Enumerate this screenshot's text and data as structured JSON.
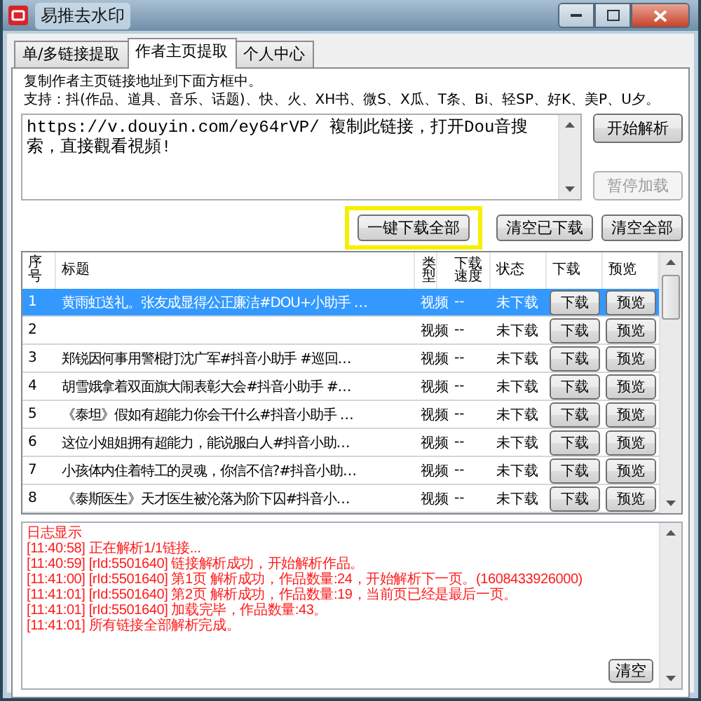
{
  "window": {
    "title": "易推去水印"
  },
  "tabs": [
    {
      "label": "单/多链接提取",
      "selected": false
    },
    {
      "label": "作者主页提取",
      "selected": true
    },
    {
      "label": "个人中心",
      "selected": false
    }
  ],
  "instructions": [
    "复制作者主页链接地址到下面方框中。",
    "支持：抖(作品、道具、音乐、话题)、快、火、XH书、微S、X瓜、T条、Bi、轻SP、好K、美P、U夕。"
  ],
  "link_input": {
    "value": "https://v.douyin.com/ey64rVP/ 複制此链接，打开Dou音搜索，直接觀看視頻!"
  },
  "side_buttons": [
    {
      "label": "开始解析",
      "disabled": false
    },
    {
      "label": "暂停加载",
      "disabled": true
    }
  ],
  "action_buttons": [
    {
      "label": "一键下载全部",
      "highlighted": true
    },
    {
      "label": "清空已下载",
      "highlighted": false
    },
    {
      "label": "清空全部",
      "highlighted": false
    }
  ],
  "table": {
    "columns": [
      "序号",
      "标题",
      "类型",
      "下载速度",
      "状态",
      "下载",
      "预览"
    ],
    "rows": [
      {
        "index": "1",
        "title": "黄雨虹送礼。张友成显得公正廉洁#DOU+小助手 …",
        "type": "视频",
        "speed": "--",
        "status": "未下载",
        "download": "下载",
        "preview": "预览",
        "selected": true
      },
      {
        "index": "2",
        "title": "",
        "type": "视频",
        "speed": "--",
        "status": "未下载",
        "download": "下载",
        "preview": "预览",
        "selected": false
      },
      {
        "index": "3",
        "title": "郑锐因何事用警棍打沈广军#抖音小助手 #巡回…",
        "type": "视频",
        "speed": "--",
        "status": "未下载",
        "download": "下载",
        "preview": "预览",
        "selected": false
      },
      {
        "index": "4",
        "title": "胡雪娥拿着双面旗大闹表彰大会#抖音小助手 #…",
        "type": "视频",
        "speed": "--",
        "status": "未下载",
        "download": "下载",
        "preview": "预览",
        "selected": false
      },
      {
        "index": "5",
        "title": "《泰坦》假如有超能力你会干什么#抖音小助手 …",
        "type": "视频",
        "speed": "--",
        "status": "未下载",
        "download": "下载",
        "preview": "预览",
        "selected": false
      },
      {
        "index": "6",
        "title": "这位小姐姐拥有超能力，能说服白人#抖音小助…",
        "type": "视频",
        "speed": "--",
        "status": "未下载",
        "download": "下载",
        "preview": "预览",
        "selected": false
      },
      {
        "index": "7",
        "title": "小孩体内住着特工的灵魂，你信不信?#抖音小助…",
        "type": "视频",
        "speed": "--",
        "status": "未下载",
        "download": "下载",
        "preview": "预览",
        "selected": false
      },
      {
        "index": "8",
        "title": "《泰斯医生》天才医生被沦落为阶下囚#抖音小…",
        "type": "视频",
        "speed": "--",
        "status": "未下载",
        "download": "下载",
        "preview": "预览",
        "selected": false
      }
    ]
  },
  "log": {
    "title": "日志显示",
    "lines": [
      "[11:40:58] 正在解析1/1链接...",
      "[11:40:59] [rId:5501640] 链接解析成功，开始解析作品。",
      "[11:41:00] [rId:5501640] 第1页 解析成功，作品数量:24，开始解析下一页。(1608433926000)",
      "[11:41:01] [rId:5501640] 第2页 解析成功，作品数量:19，当前页已经是最后一页。",
      "[11:41:01] [rId:5501640] 加载完毕，作品数量:43。",
      "[11:41:01] 所有链接全部解析完成。"
    ],
    "clear_button": "清空"
  }
}
